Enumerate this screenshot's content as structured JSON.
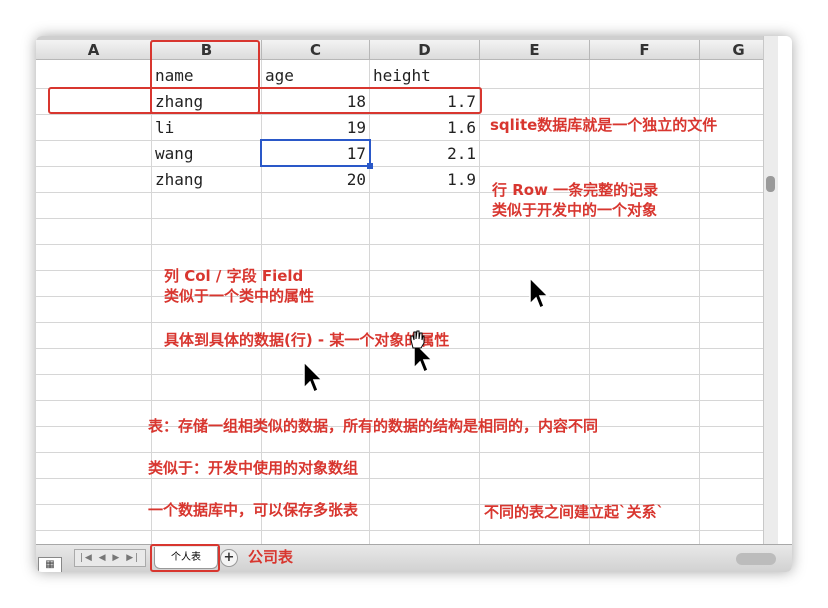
{
  "columns": [
    "A",
    "B",
    "C",
    "D",
    "E",
    "F",
    "G"
  ],
  "table": {
    "headers": [
      "name",
      "age",
      "height"
    ],
    "rows": [
      {
        "name": "zhang",
        "age": "18",
        "height": "1.7"
      },
      {
        "name": "li",
        "age": "19",
        "height": "1.6"
      },
      {
        "name": "wang",
        "age": "17",
        "height": "2.1"
      },
      {
        "name": "zhang",
        "age": "20",
        "height": "1.9"
      }
    ]
  },
  "annotations": {
    "sqlite_file": "sqlite数据库就是一个独立的文件",
    "row_title": "行 Row 一条完整的记录",
    "row_desc": "类似于开发中的一个对象",
    "col_title": "列 Col / 字段 Field",
    "col_desc": "类似于一个类中的属性",
    "cell_desc": "具体到具体的数据(行) - 某一个对象的属性",
    "table_desc": "表：存储一组相类似的数据，所有的数据的结构是相同的，内容不同",
    "table_similar": "类似于：开发中使用的对象数组",
    "db_multi": "一个数据库中，可以保存多张表",
    "relation": "不同的表之间建立起`关系`",
    "company_table": "公司表"
  },
  "sheet_tabs": {
    "active": "个人表",
    "add_label": "+",
    "nav_label": "|◀ ◀ ▶ ▶|"
  },
  "colors": {
    "annotation_red": "#d8362f",
    "selection_blue": "#2a58c8"
  },
  "icons": [
    "cursor-arrow-icon",
    "hand-cursor-icon",
    "add-sheet-icon",
    "grid-view-icon"
  ]
}
